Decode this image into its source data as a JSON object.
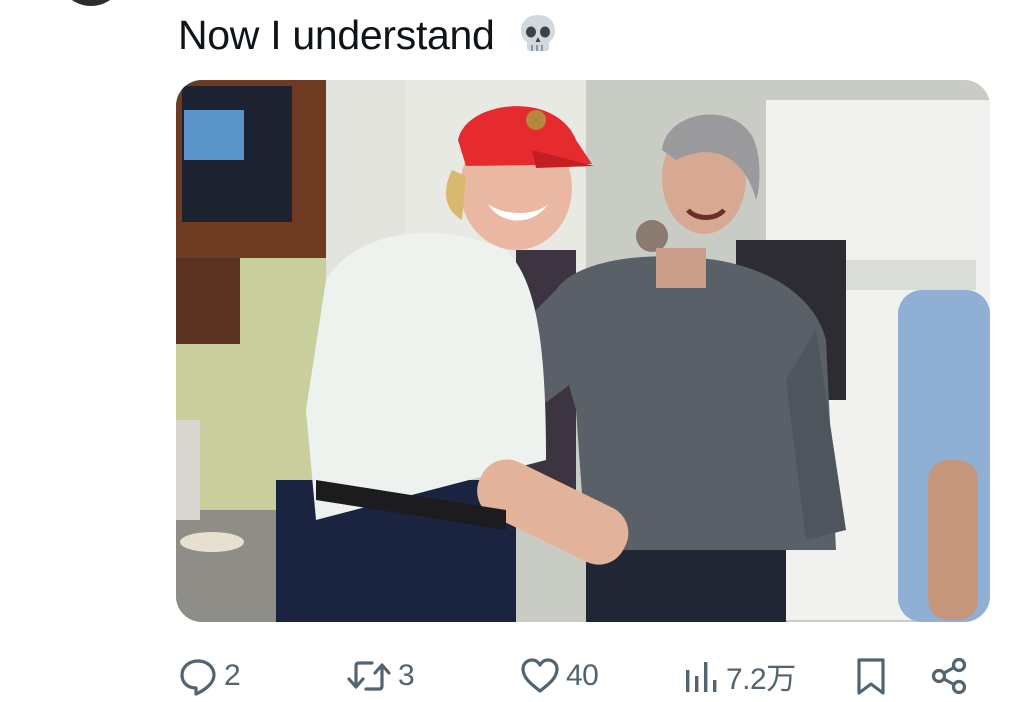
{
  "tweet": {
    "text": "Now I understand",
    "emoji_icon": "skull-icon"
  },
  "media": {
    "kind": "photo"
  },
  "actions": {
    "reply_count": "2",
    "retweet_count": "3",
    "like_count": "40",
    "views_count": "7.2万"
  },
  "icons": {
    "reply": "comment-bubble-icon",
    "retweet": "retweet-icon",
    "like": "heart-icon",
    "views": "bar-chart-icon",
    "bookmark": "bookmark-icon",
    "share": "share-icon"
  },
  "colors": {
    "text": "#0f1419",
    "secondary": "#536471",
    "background": "#ffffff"
  }
}
